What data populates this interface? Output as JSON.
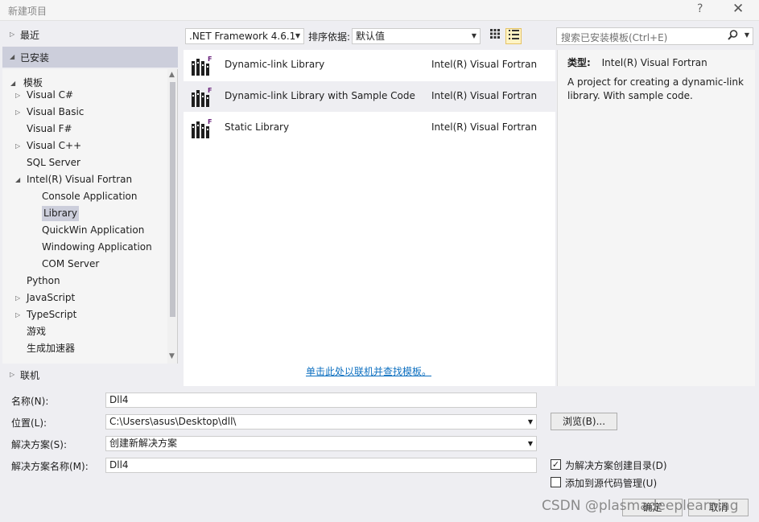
{
  "window": {
    "title": "新建项目",
    "help": "?",
    "close": "✕"
  },
  "left_nav": {
    "recent": "最近",
    "installed": "已安装",
    "online": "联机",
    "templates_root": "模板",
    "tree": [
      {
        "label": "Visual C#",
        "expander": "▷"
      },
      {
        "label": "Visual Basic",
        "expander": "▷"
      },
      {
        "label": "Visual F#",
        "expander": ""
      },
      {
        "label": "Visual C++",
        "expander": "▷"
      },
      {
        "label": "SQL Server",
        "expander": ""
      },
      {
        "label": "Intel(R) Visual Fortran",
        "expander": "◢"
      },
      {
        "label": "Console Application",
        "expander": ""
      },
      {
        "label": "Library",
        "expander": ""
      },
      {
        "label": "QuickWin Application",
        "expander": ""
      },
      {
        "label": "Windowing Application",
        "expander": ""
      },
      {
        "label": "COM Server",
        "expander": ""
      },
      {
        "label": "Python",
        "expander": ""
      },
      {
        "label": "JavaScript",
        "expander": "▷"
      },
      {
        "label": "TypeScript",
        "expander": "▷"
      },
      {
        "label": "游戏",
        "expander": ""
      },
      {
        "label": "生成加速器",
        "expander": ""
      }
    ]
  },
  "toolbar": {
    "framework": ".NET Framework 4.6.1",
    "sort_label": "排序依据:",
    "sort_value": "默认值",
    "grid_view_icon": "grid-view-icon",
    "list_view_icon": "list-view-icon"
  },
  "search": {
    "placeholder": "搜索已安装模板(Ctrl+E)"
  },
  "templates": [
    {
      "name": "Dynamic-link Library",
      "language": "Intel(R) Visual Fortran"
    },
    {
      "name": "Dynamic-link Library with Sample Code",
      "language": "Intel(R) Visual Fortran"
    },
    {
      "name": "Static Library",
      "language": "Intel(R) Visual Fortran"
    }
  ],
  "online_link": "单击此处以联机并查找模板。",
  "details": {
    "type_label": "类型:",
    "type_value": "Intel(R) Visual Fortran",
    "description": "A project for creating a dynamic-link library. With sample code."
  },
  "form": {
    "name_label": "名称(N):",
    "name_value": "Dll4",
    "location_label": "位置(L):",
    "location_value": "C:\\Users\\asus\\Desktop\\dll\\",
    "browse": "浏览(B)...",
    "solution_label": "解决方案(S):",
    "solution_value": "创建新解决方案",
    "solution_name_label": "解决方案名称(M):",
    "solution_name_value": "Dll4",
    "create_dir": "为解决方案创建目录(D)",
    "source_control": "添加到源代码管理(U)",
    "ok": "确定",
    "cancel": "取消"
  },
  "watermark": "CSDN @plasmadeeplearning"
}
